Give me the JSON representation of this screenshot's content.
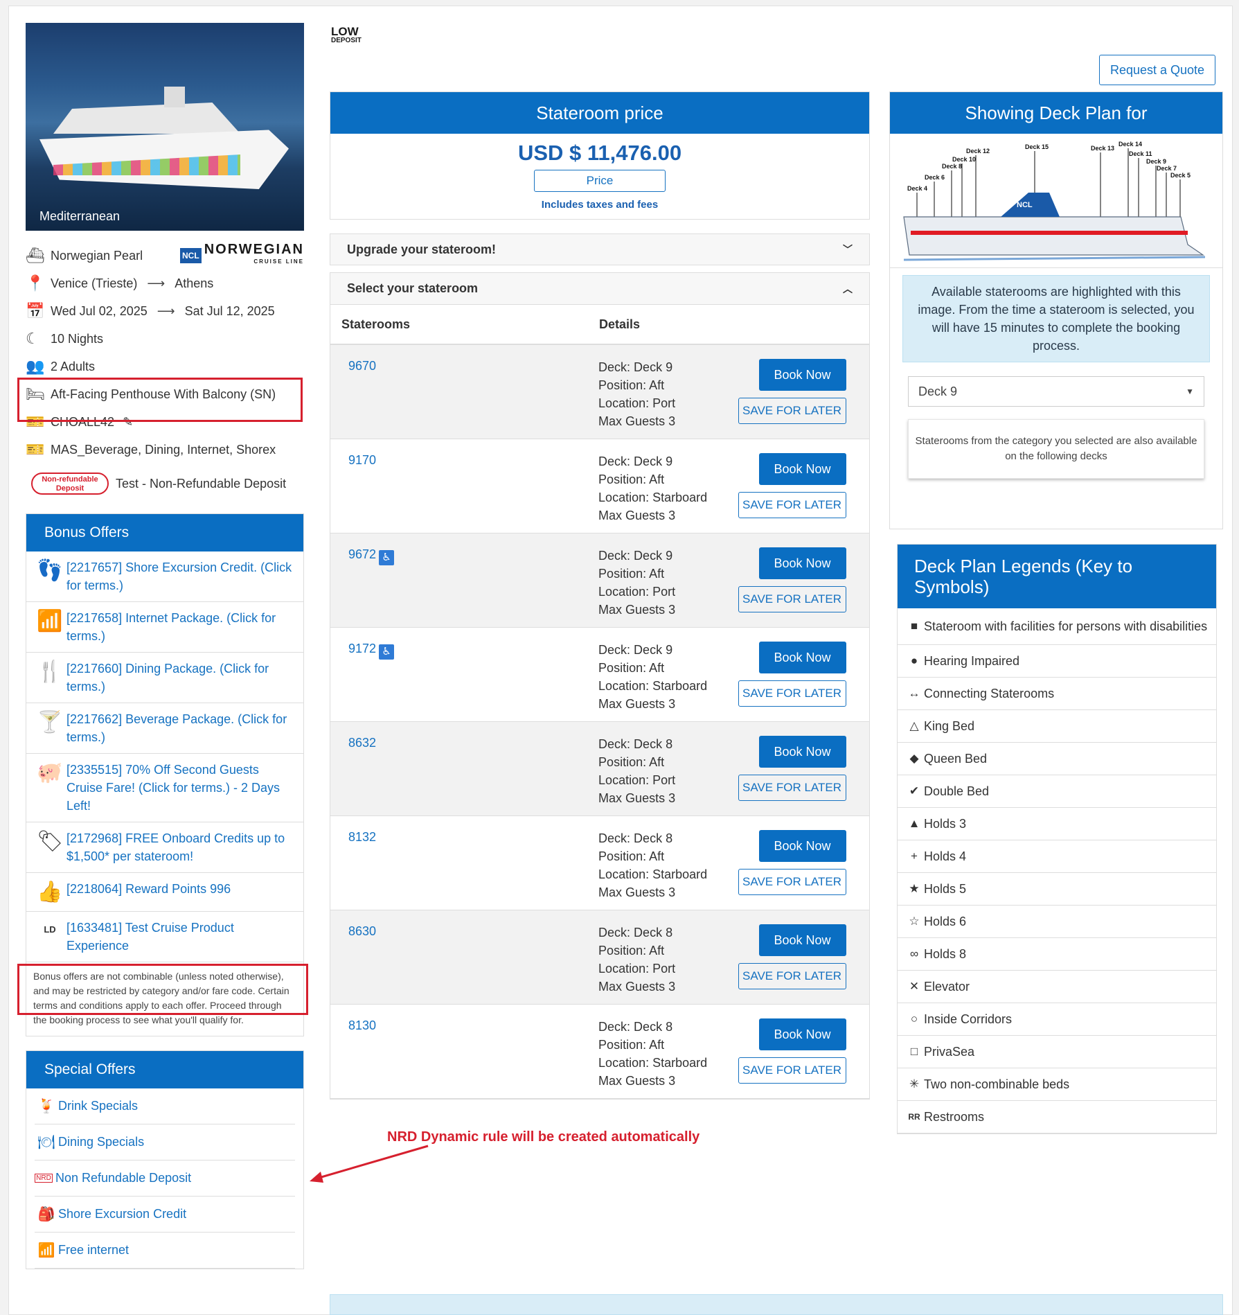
{
  "trip": {
    "region": "Mediterranean",
    "ship": "Norwegian Pearl",
    "cruise_line_abbr": "NCL",
    "cruise_line_name": "NORWEGIAN",
    "cruise_line_sub": "CRUISE LINE",
    "port_from": "Venice (Trieste)",
    "port_to": "Athens",
    "date_from": "Wed Jul 02, 2025",
    "date_to": "Sat Jul 12, 2025",
    "nights": "10 Nights",
    "guests": "2 Adults",
    "category": "Aft-Facing Penthouse With Balcony (SN)",
    "promo_code": "CHOALL42",
    "package": "MAS_Beverage, Dining, Internet, Shorex",
    "nrd_badge": "Non-refundable Deposit",
    "nrd_label": "Test - Non-Refundable Deposit"
  },
  "bonus": {
    "title": "Bonus Offers",
    "items": [
      {
        "text": "[2217657] Shore Excursion Credit. (Click for terms.)",
        "icon": "flip-flops-icon"
      },
      {
        "text": "[2217658] Internet Package. (Click for terms.)",
        "icon": "wifi-icon"
      },
      {
        "text": "[2217660] Dining Package. (Click for terms.)",
        "icon": "dining-icon"
      },
      {
        "text": "[2217662] Beverage Package. (Click for terms.)",
        "icon": "cocktail-icon"
      },
      {
        "text": "[2335515] 70% Off Second Guests Cruise Fare! (Click for terms.) - 2 Days Left!",
        "icon": "piggy-bank-icon"
      },
      {
        "text": "[2172968] FREE Onboard Credits up to $1,500* per stateroom!",
        "icon": "sale-tag-icon"
      },
      {
        "text": "[2218064] Reward Points 996",
        "icon": "thumbs-up-icon"
      },
      {
        "text": "[1633481] Test Cruise Product Experience",
        "icon": "low-deposit-icon"
      }
    ],
    "note": "Bonus offers are not combinable (unless noted otherwise), and may be restricted by category and/or fare code. Certain terms and conditions apply to each offer. Proceed through the booking process to see what you'll qualify for."
  },
  "special": {
    "title": "Special Offers",
    "items": [
      "Drink Specials",
      "Dining Specials",
      "Non Refundable Deposit",
      "Shore Excursion Credit",
      "Free internet"
    ]
  },
  "low_deposit": {
    "line1": "LOW",
    "line2": "DEPOSIT"
  },
  "quote_button": "Request a Quote",
  "price": {
    "title": "Stateroom price",
    "value": "USD $ 11,476.00",
    "button": "Price",
    "note": "Includes taxes and fees"
  },
  "upgrade_label": "Upgrade your stateroom!",
  "select_label": "Select your stateroom",
  "table": {
    "col_staterooms": "Staterooms",
    "col_details": "Details",
    "book_label": "Book Now",
    "save_label": "SAVE FOR LATER",
    "rows": [
      {
        "num": "9670",
        "deck": "Deck: Deck 9",
        "pos": "Position: Aft",
        "loc": "Location: Port",
        "max": "Max Guests 3"
      },
      {
        "num": "9170",
        "deck": "Deck: Deck 9",
        "pos": "Position: Aft",
        "loc": "Location: Starboard",
        "max": "Max Guests 3"
      },
      {
        "num": "9672",
        "deck": "Deck: Deck 9",
        "pos": "Position: Aft",
        "loc": "Location: Port",
        "max": "Max Guests 3"
      },
      {
        "num": "9172",
        "deck": "Deck: Deck 9",
        "pos": "Position: Aft",
        "loc": "Location: Starboard",
        "max": "Max Guests 3"
      },
      {
        "num": "8632",
        "deck": "Deck: Deck 8",
        "pos": "Position: Aft",
        "loc": "Location: Port",
        "max": "Max Guests 3"
      },
      {
        "num": "8132",
        "deck": "Deck: Deck 8",
        "pos": "Position: Aft",
        "loc": "Location: Starboard",
        "max": "Max Guests 3"
      },
      {
        "num": "8630",
        "deck": "Deck: Deck 8",
        "pos": "Position: Aft",
        "loc": "Location: Port",
        "max": "Max Guests 3"
      },
      {
        "num": "8130",
        "deck": "Deck: Deck 8",
        "pos": "Position: Aft",
        "loc": "Location: Starboard",
        "max": "Max Guests 3"
      }
    ]
  },
  "annotation": "NRD Dynamic rule will be created automatically",
  "deck_plan": {
    "title": "Showing Deck Plan for",
    "deck_labels": [
      "Deck 12",
      "Deck 15",
      "Deck 13",
      "Deck 14",
      "Deck 10",
      "Deck 11",
      "Deck 8",
      "Deck 9",
      "Deck 7",
      "Deck 6",
      "Deck 5",
      "Deck 4"
    ],
    "ship_logo": "NCL",
    "info": "Available staterooms are highlighted with this image. From the time a stateroom is selected, you will have 15 minutes to complete the booking process.",
    "selected_deck": "Deck 9",
    "note": "Staterooms from the category you selected are also available on the following decks"
  },
  "legend": {
    "title": "Deck Plan Legends (Key to Symbols)",
    "items": [
      {
        "sym": "■",
        "text": "Stateroom with facilities for persons with disabilities"
      },
      {
        "sym": "●",
        "text": "Hearing Impaired"
      },
      {
        "sym": "↔",
        "text": "Connecting Staterooms"
      },
      {
        "sym": "△",
        "text": "King Bed"
      },
      {
        "sym": "◆",
        "text": "Queen Bed"
      },
      {
        "sym": "✔",
        "text": "Double Bed"
      },
      {
        "sym": "▲",
        "text": "Holds 3"
      },
      {
        "sym": "+",
        "text": "Holds 4"
      },
      {
        "sym": "★",
        "text": "Holds 5"
      },
      {
        "sym": "☆",
        "text": "Holds 6"
      },
      {
        "sym": "∞",
        "text": "Holds 8"
      },
      {
        "sym": "✕",
        "text": "Elevator"
      },
      {
        "sym": "○",
        "text": "Inside Corridors"
      },
      {
        "sym": "□",
        "text": "PrivaSea"
      },
      {
        "sym": "✳",
        "text": "Two non-combinable beds"
      },
      {
        "sym": "RR",
        "text": "Restrooms"
      }
    ]
  },
  "colors": {
    "primary": "#0a6ec2",
    "link": "#1672c1",
    "annotation": "#d6202e"
  }
}
